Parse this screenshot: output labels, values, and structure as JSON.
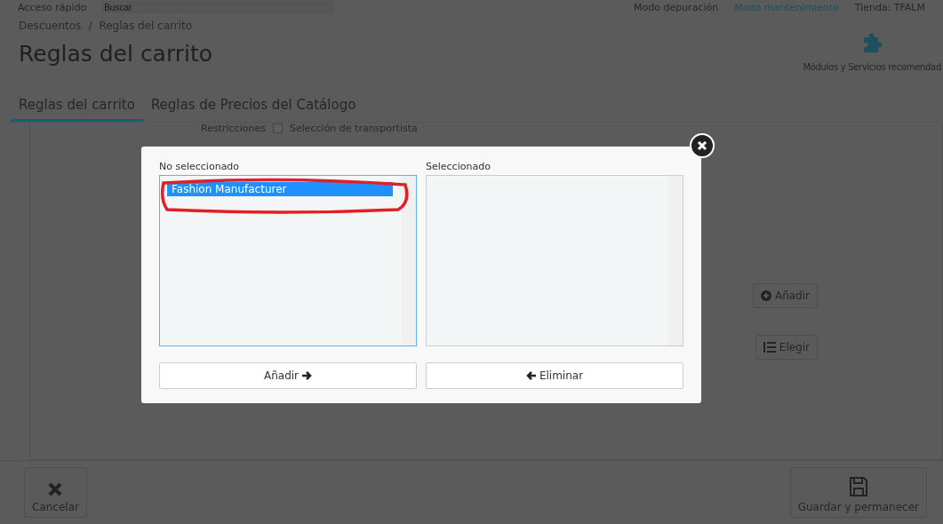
{
  "top_bar": {
    "quick_access": "Acceso rápido",
    "search": {
      "placeholder": "Buscar"
    },
    "debug_mode": "Modo depuración",
    "maintenance_mode": "Modo mantenimiento",
    "shop": "Tienda: TFALM"
  },
  "breadcrumb": [
    "Descuentos",
    "Reglas del carrito"
  ],
  "breadcrumb_separator": "/",
  "title": "Reglas del carrito",
  "header_action": "Módulos y Servicios recomendad",
  "tabs": [
    {
      "label": "Reglas del carrito",
      "selected": true
    },
    {
      "label": "Reglas de Precios del Catálogo",
      "selected": false
    }
  ],
  "background_form": {
    "restrictions_label": "Restricciones",
    "carrier_option": {
      "label": "Selección de transportista",
      "checked": false
    },
    "add_button": "Añadir",
    "choose_button": "Elegir"
  },
  "footer": {
    "cancel": "Cancelar",
    "save_stay": "Guardar y permanecer"
  },
  "modal": {
    "left": {
      "label": "No seleccionado",
      "items": [
        {
          "text": "Fashion Manufacturer",
          "selected": true
        }
      ]
    },
    "right": {
      "label": "Seleccionado"
    },
    "add_button": "Añadir",
    "remove_button": "Eliminar"
  }
}
